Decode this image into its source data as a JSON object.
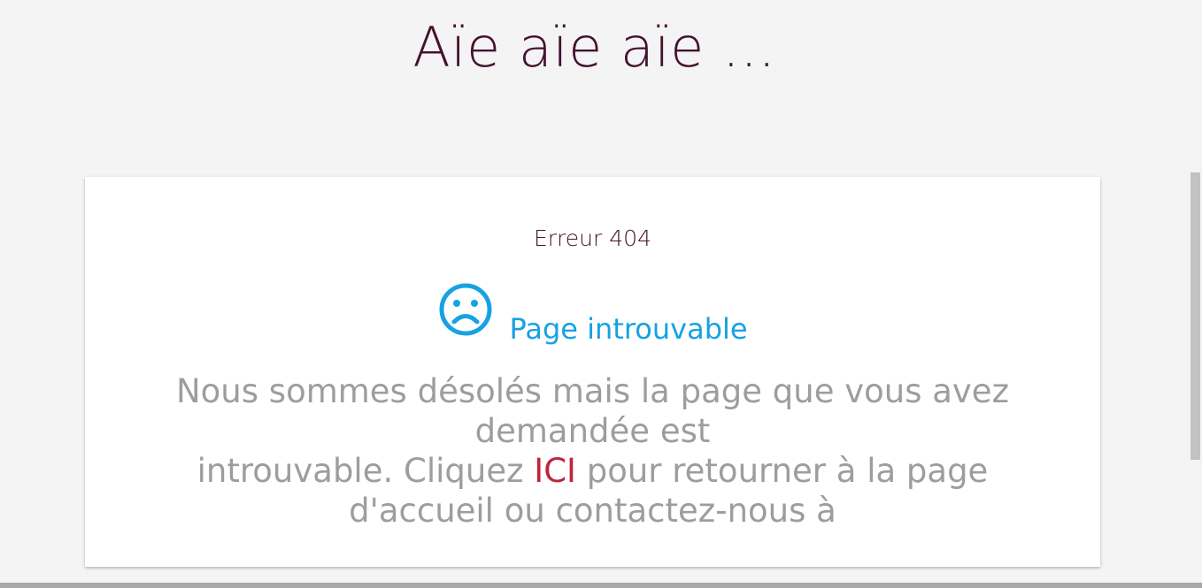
{
  "header": {
    "title": "Aïe aïe aïe ..."
  },
  "card": {
    "error_code": "Erreur 404",
    "subtitle": "Page introuvable",
    "icon": "sad-face-icon",
    "message": {
      "line1": "Nous sommes désolés mais la page que vous avez demandée est",
      "line2_before": "introuvable. Cliquez ",
      "link_label": "ICI",
      "line2_after": " pour retourner à la page d'accueil ou contactez-nous à"
    }
  },
  "colors": {
    "title": "#45122f",
    "accent_blue": "#16a2e3",
    "link_red": "#c0243b",
    "message_gray": "#9d9d9d",
    "background": "#f4f4f4"
  }
}
